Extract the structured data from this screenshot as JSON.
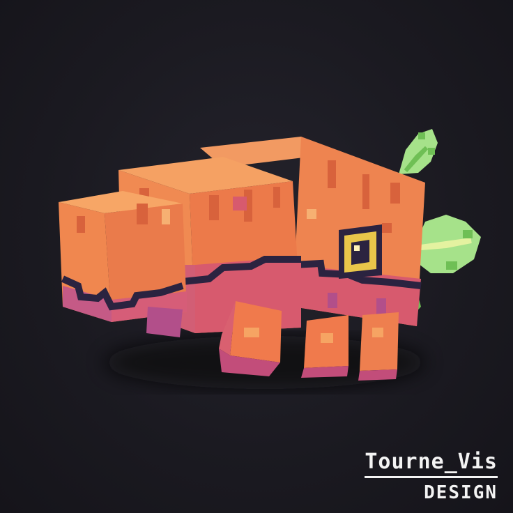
{
  "scene": {
    "subject": "voxel-creature",
    "colors": {
      "background": "#1b1a21",
      "orange_light": "#f4935a",
      "orange_mid": "#ec7a4a",
      "orange_dark": "#d8623c",
      "pink": "#d75a6e",
      "purple": "#b24f8a",
      "mouth_line": "#2b2340",
      "eye_gold": "#e9c64a",
      "leaf_light": "#a6e28a",
      "leaf_dark": "#6fbf55"
    }
  },
  "watermark": {
    "line1": "Tourne_Vis",
    "line2": "DESIGN"
  }
}
